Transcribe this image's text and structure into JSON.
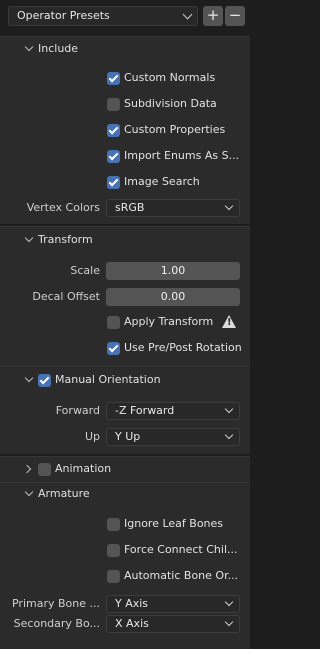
{
  "presets": {
    "label": "Operator Presets",
    "add": "+",
    "remove": "−"
  },
  "include": {
    "title": "Include",
    "options": [
      {
        "label": "Custom Normals",
        "checked": true
      },
      {
        "label": "Subdivision Data",
        "checked": false
      },
      {
        "label": "Custom Properties",
        "checked": true
      },
      {
        "label": "Import Enums As S...",
        "checked": true
      },
      {
        "label": "Image Search",
        "checked": true
      }
    ],
    "vertex_colors_label": "Vertex Colors",
    "vertex_colors_value": "sRGB"
  },
  "transform": {
    "title": "Transform",
    "scale_label": "Scale",
    "scale_value": "1.00",
    "decal_label": "Decal Offset",
    "decal_value": "0.00",
    "apply_transform": {
      "label": "Apply Transform",
      "checked": false
    },
    "use_prepost": {
      "label": "Use Pre/Post Rotation",
      "checked": true
    }
  },
  "manual_orientation": {
    "title": "Manual Orientation",
    "checked": true,
    "forward_label": "Forward",
    "forward_value": "-Z Forward",
    "up_label": "Up",
    "up_value": "Y Up"
  },
  "animation": {
    "title": "Animation",
    "checked": false
  },
  "armature": {
    "title": "Armature",
    "options": [
      {
        "label": "Ignore Leaf Bones",
        "checked": false
      },
      {
        "label": "Force Connect Chil...",
        "checked": false
      },
      {
        "label": "Automatic Bone Or...",
        "checked": false
      }
    ],
    "primary_label": "Primary Bone ...",
    "primary_value": "Y Axis",
    "secondary_label": "Secondary Bo...",
    "secondary_value": "X Axis"
  }
}
